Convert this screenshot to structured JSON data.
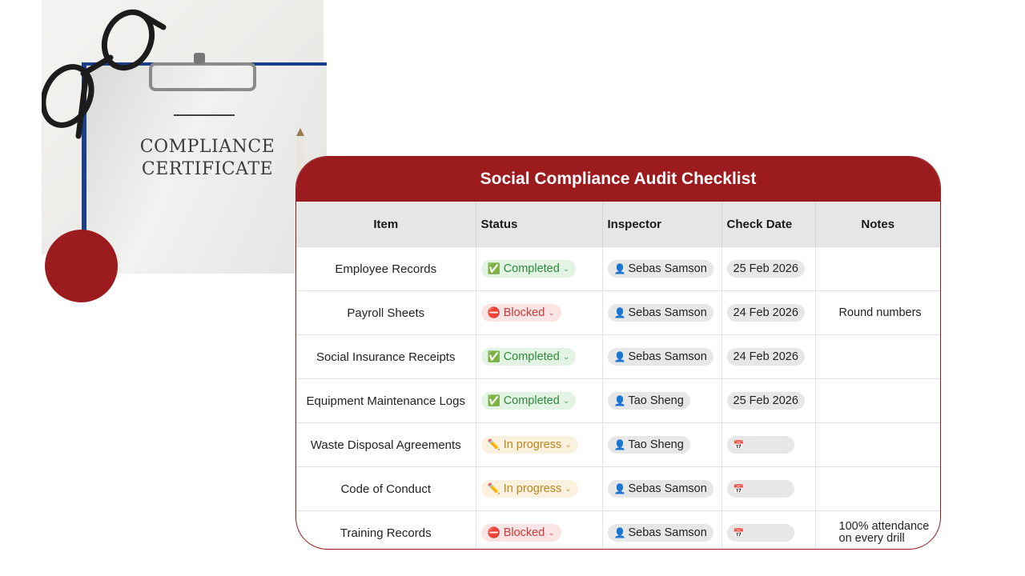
{
  "image": {
    "certificate_line1": "COMPLIANCE",
    "certificate_line2": "CERTIFICATE"
  },
  "table": {
    "title": "Social Compliance Audit Checklist",
    "headers": {
      "item": "Item",
      "status": "Status",
      "inspector": "Inspector",
      "check_date": "Check Date",
      "notes": "Notes"
    },
    "rows": [
      {
        "item": "Employee Records",
        "status": "Completed",
        "status_icon": "check-box-icon",
        "inspector": "Sebas Samson",
        "check_date": "25 Feb 2026",
        "notes": ""
      },
      {
        "item": "Payroll Sheets",
        "status": "Blocked",
        "status_icon": "no-entry-icon",
        "inspector": "Sebas Samson",
        "check_date": "24 Feb 2026",
        "notes": "Round numbers"
      },
      {
        "item": "Social Insurance Receipts",
        "status": "Completed",
        "status_icon": "check-box-icon",
        "inspector": "Sebas Samson",
        "check_date": "24 Feb 2026",
        "notes": ""
      },
      {
        "item": "Equipment Maintenance Logs",
        "status": "Completed",
        "status_icon": "check-box-icon",
        "inspector": "Tao Sheng",
        "check_date": "25 Feb 2026",
        "notes": ""
      },
      {
        "item": "Waste Disposal Agreements",
        "status": "In progress",
        "status_icon": "pencil-icon",
        "inspector": "Tao Sheng",
        "check_date": "",
        "notes": ""
      },
      {
        "item": "Code of Conduct",
        "status": "In progress",
        "status_icon": "pencil-icon",
        "inspector": "Sebas Samson",
        "check_date": "",
        "notes": ""
      },
      {
        "item": "Training Records",
        "status": "Blocked",
        "status_icon": "no-entry-icon",
        "inspector": "Sebas Samson",
        "check_date": "",
        "notes_line1": "100% attendance",
        "notes_line2": "on every drill"
      }
    ]
  },
  "colors": {
    "accent": "#9b1b1e",
    "completed": "#2f8a3a",
    "blocked": "#c93a3a",
    "in_progress": "#b9861e"
  }
}
